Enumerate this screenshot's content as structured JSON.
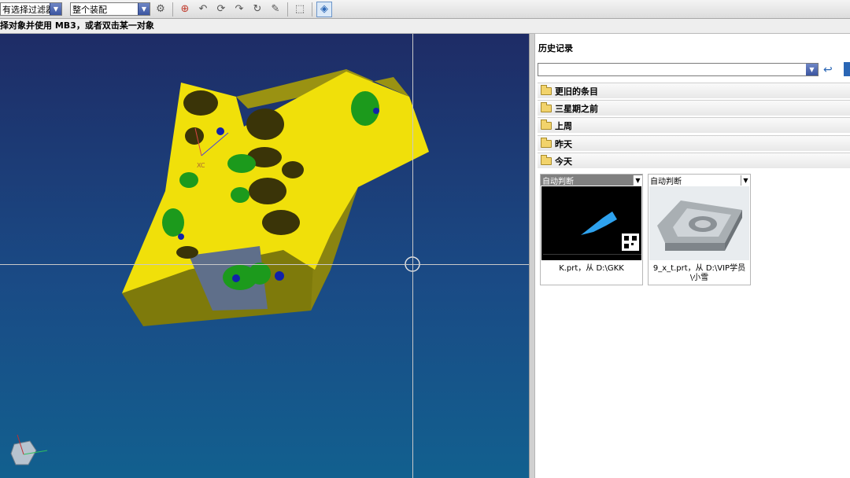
{
  "toolbar": {
    "filter_select": "有选择过滤器",
    "assembly_select": "整个装配"
  },
  "status": {
    "prompt": "择对象并使用 MB3，或者双击某一对象"
  },
  "viewport": {
    "triad_label": "XC"
  },
  "history": {
    "title": "历史记录",
    "search_value": "",
    "groups": [
      {
        "label": "更旧的条目"
      },
      {
        "label": "三星期之前"
      },
      {
        "label": "上周"
      },
      {
        "label": "昨天"
      },
      {
        "label": "今天"
      }
    ],
    "cards": [
      {
        "mode": "自动判断",
        "caption": "K.prt，从 D:\\GKK"
      },
      {
        "mode": "自动判断",
        "caption": "9_x_t.prt，从 D:\\VIP学员\\小雪"
      }
    ]
  }
}
